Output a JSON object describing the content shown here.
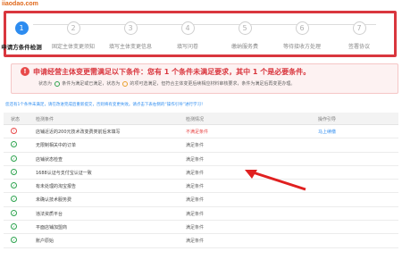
{
  "watermark": "iiaodao.com",
  "stepper": {
    "steps": [
      {
        "number": "1",
        "label": "申请方条件检测",
        "active": true
      },
      {
        "number": "2",
        "label": "固定主体变更须知",
        "active": false
      },
      {
        "number": "3",
        "label": "填写主体变更信息",
        "active": false
      },
      {
        "number": "4",
        "label": "填写问卷",
        "active": false
      },
      {
        "number": "5",
        "label": "缴纳服务费",
        "active": false
      },
      {
        "number": "6",
        "label": "等待接收方处理",
        "active": false
      },
      {
        "number": "7",
        "label": "签署协议",
        "active": false
      }
    ]
  },
  "notice": {
    "icon": "!",
    "title": "申请经营主体变更需满足以下条件：您有 1 个条件未满足要求，其中 1 个是必要条件。",
    "legend_prefix": "状态为",
    "legend_ok_text": "条件为满足或已满足，状态为",
    "legend_warn_text": "的项可选满足，但符合主体变更后续相应材料审核要求，条件为满足后再变更办理。"
  },
  "info_line": "您还有1个条件未满足，请在改进完成后重新提交，否则将有变更失败。请点击下表右侧的“操作引导”进行学习！",
  "table": {
    "headers": {
      "status": "状态",
      "condition": "检测条件",
      "result": "检测情况",
      "action": "操作引导"
    },
    "rows": [
      {
        "ok": false,
        "status_icon": "!",
        "condition": "店铺近近的200元技术改变费类前后未填写",
        "result": "不满足条件",
        "action": "马上续缴"
      },
      {
        "ok": true,
        "status_icon": "✓",
        "condition": "无限制相关中的订单",
        "result": "满足条件",
        "action": ""
      },
      {
        "ok": true,
        "status_icon": "✓",
        "condition": "店铺状态检查",
        "result": "满足条件",
        "action": ""
      },
      {
        "ok": true,
        "status_icon": "✓",
        "condition": "1688认证与支付宝认证一致",
        "result": "满足条件",
        "action": ""
      },
      {
        "ok": true,
        "status_icon": "✓",
        "condition": "有未处理的淘宝报告",
        "result": "满足条件",
        "action": ""
      },
      {
        "ok": true,
        "status_icon": "✓",
        "condition": "未确认技术服务费",
        "result": "满足条件",
        "action": ""
      },
      {
        "ok": true,
        "status_icon": "✓",
        "condition": "违法资质平台",
        "result": "满足条件",
        "action": ""
      },
      {
        "ok": true,
        "status_icon": "✓",
        "condition": "平面店铺加盟商",
        "result": "满足条件",
        "action": ""
      },
      {
        "ok": true,
        "status_icon": "✓",
        "condition": "账户原始",
        "result": "满足条件",
        "action": ""
      }
    ]
  },
  "colors": {
    "accent": "#2d8cf0",
    "error": "#e84a4a",
    "success": "#2ea44f",
    "highlight_frame": "#d9363e"
  }
}
